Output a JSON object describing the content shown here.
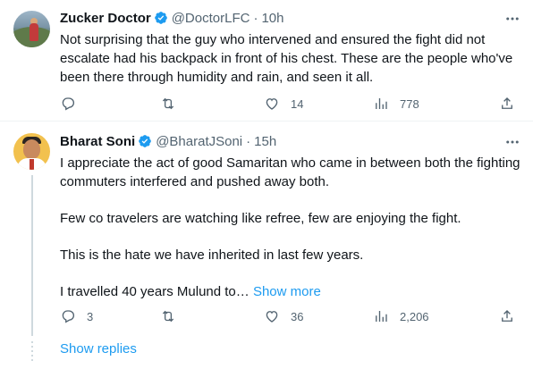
{
  "tweets": [
    {
      "name": "Zucker Doctor",
      "handle": "@DoctorLFC",
      "separator": "·",
      "time": "10h",
      "text": "Not surprising that the guy who intervened and ensured the fight did not escalate had his backpack in front of his chest. These are the people who've been there through humidity and rain, and seen it all.",
      "replies": "",
      "retweets": "",
      "likes": "14",
      "views": "778"
    },
    {
      "name": "Bharat Soni",
      "handle": "@BharatJSoni",
      "separator": "·",
      "time": "15h",
      "paragraphs": [
        "I appreciate the act of good Samaritan who came in between both the fighting commuters interfered and pushed away both.",
        "Few co travelers are watching like refree, few are enjoying the fight.",
        "This is the hate we have inherited in last few years.",
        "I travelled 40 years Mulund to…"
      ],
      "show_more": "Show more",
      "replies": "3",
      "retweets": "",
      "likes": "36",
      "views": "2,206"
    }
  ],
  "show_replies": "Show replies",
  "icons": {
    "verified": "verified-badge-icon",
    "more": "more-options-icon",
    "reply": "reply-icon",
    "retweet": "retweet-icon",
    "like": "heart-icon",
    "views": "views-icon",
    "share": "share-icon"
  },
  "colors": {
    "accent": "#1d9bf0",
    "text": "#0f1419",
    "muted": "#536471",
    "divider": "#eff3f4"
  }
}
